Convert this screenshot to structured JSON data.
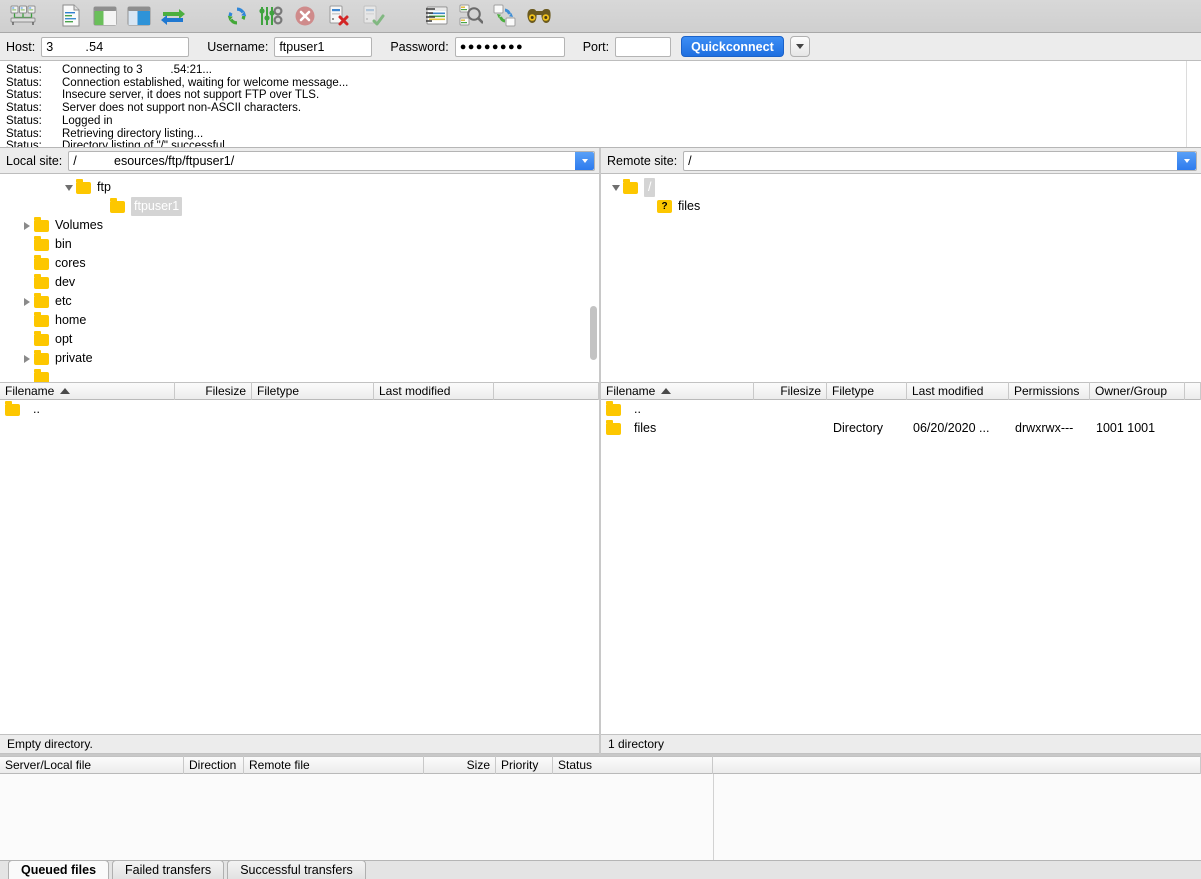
{
  "toolbar": {
    "buttons": [
      {
        "name": "site-manager-icon",
        "title": "Open the Site Manager"
      },
      {
        "name": "toggle-message-log-icon",
        "title": "Toggles the display of the message log"
      },
      {
        "name": "toggle-local-tree-icon",
        "title": "Toggles the display of the local directory tree"
      },
      {
        "name": "toggle-remote-tree-icon",
        "title": "Toggles the display of the remote directory tree"
      },
      {
        "name": "toggle-transfer-queue-icon",
        "title": "Toggles the display of the transfer queue"
      },
      {
        "name": "refresh-icon",
        "title": "Refresh the file and folder lists"
      },
      {
        "name": "process-queue-icon",
        "title": "Process queue"
      },
      {
        "name": "cancel-operation-icon",
        "title": "Cancel current operation"
      },
      {
        "name": "disconnect-icon",
        "title": "Disconnects from the currently visible server"
      },
      {
        "name": "reconnect-icon",
        "title": "Reconnects to the last used server"
      },
      {
        "name": "filter-icon",
        "title": "Open the directory listing filter dialog"
      },
      {
        "name": "compare-directories-icon",
        "title": "Toggle directory comparison"
      },
      {
        "name": "synchronized-browsing-icon",
        "title": "Toggle synchronized browsing"
      },
      {
        "name": "find-files-icon",
        "title": "Search for files recursively"
      }
    ]
  },
  "quickconnect": {
    "host_label": "Host:",
    "host_value": "3         .54",
    "username_label": "Username:",
    "username_value": "ftpuser1",
    "password_label": "Password:",
    "password_value": "●●●●●●●●",
    "port_label": "Port:",
    "port_value": "",
    "button_label": "Quickconnect",
    "dropdown_icon": "chevron-down-icon"
  },
  "log": {
    "prefix": "Status:",
    "entries": [
      "Connecting to 3         .54:21...",
      "Connection established, waiting for welcome message...",
      "Insecure server, it does not support FTP over TLS.",
      "Server does not support non-ASCII characters.",
      "Logged in",
      "Retrieving directory listing...",
      "Directory listing of \"/\" successful"
    ]
  },
  "local": {
    "site_label": "Local site:",
    "site_path": "/           esources/ftp/ftpuser1/",
    "tree": [
      {
        "label": "ftp",
        "indent": 4,
        "twist": "down",
        "selected": false
      },
      {
        "label": "ftpuser1",
        "indent": 6,
        "twist": "none",
        "selected": true
      },
      {
        "label": "Volumes",
        "indent": 2,
        "twist": "right",
        "selected": false
      },
      {
        "label": "bin",
        "indent": 2,
        "twist": "none",
        "selected": false
      },
      {
        "label": "cores",
        "indent": 2,
        "twist": "none",
        "selected": false
      },
      {
        "label": "dev",
        "indent": 2,
        "twist": "none",
        "selected": false
      },
      {
        "label": "etc",
        "indent": 2,
        "twist": "right",
        "selected": false
      },
      {
        "label": "home",
        "indent": 2,
        "twist": "none",
        "selected": false
      },
      {
        "label": "opt",
        "indent": 2,
        "twist": "none",
        "selected": false
      },
      {
        "label": "private",
        "indent": 2,
        "twist": "right",
        "selected": false
      }
    ],
    "columns": [
      "Filename",
      "Filesize",
      "Filetype",
      "Last modified"
    ],
    "sort_column": "Filename",
    "sort_direction": "ascending",
    "rows": [
      {
        "filename": "..",
        "filesize": "",
        "filetype": "",
        "modified": ""
      }
    ],
    "status": "Empty directory."
  },
  "remote": {
    "site_label": "Remote site:",
    "site_path": "/",
    "tree": [
      {
        "label": "/",
        "indent": 1,
        "twist": "down",
        "selected": true,
        "icon": "folder-icon"
      },
      {
        "label": "files",
        "indent": 3,
        "twist": "none",
        "selected": false,
        "icon": "unknown-folder-icon"
      }
    ],
    "columns": [
      "Filename",
      "Filesize",
      "Filetype",
      "Last modified",
      "Permissions",
      "Owner/Group"
    ],
    "sort_column": "Filename",
    "sort_direction": "ascending",
    "rows": [
      {
        "filename": "..",
        "filesize": "",
        "filetype": "",
        "modified": "",
        "permissions": "",
        "owner": ""
      },
      {
        "filename": "files",
        "filesize": "",
        "filetype": "Directory",
        "modified": "06/20/2020 ...",
        "permissions": "drwxrwx---",
        "owner": "1001 1001"
      }
    ],
    "status": "1 directory"
  },
  "queue": {
    "columns": [
      "Server/Local file",
      "Direction",
      "Remote file",
      "",
      "Size",
      "Priority",
      "Status"
    ],
    "rows": [],
    "tabs": [
      {
        "label": "Queued files",
        "active": true
      },
      {
        "label": "Failed transfers",
        "active": false
      },
      {
        "label": "Successful transfers",
        "active": false
      }
    ]
  }
}
